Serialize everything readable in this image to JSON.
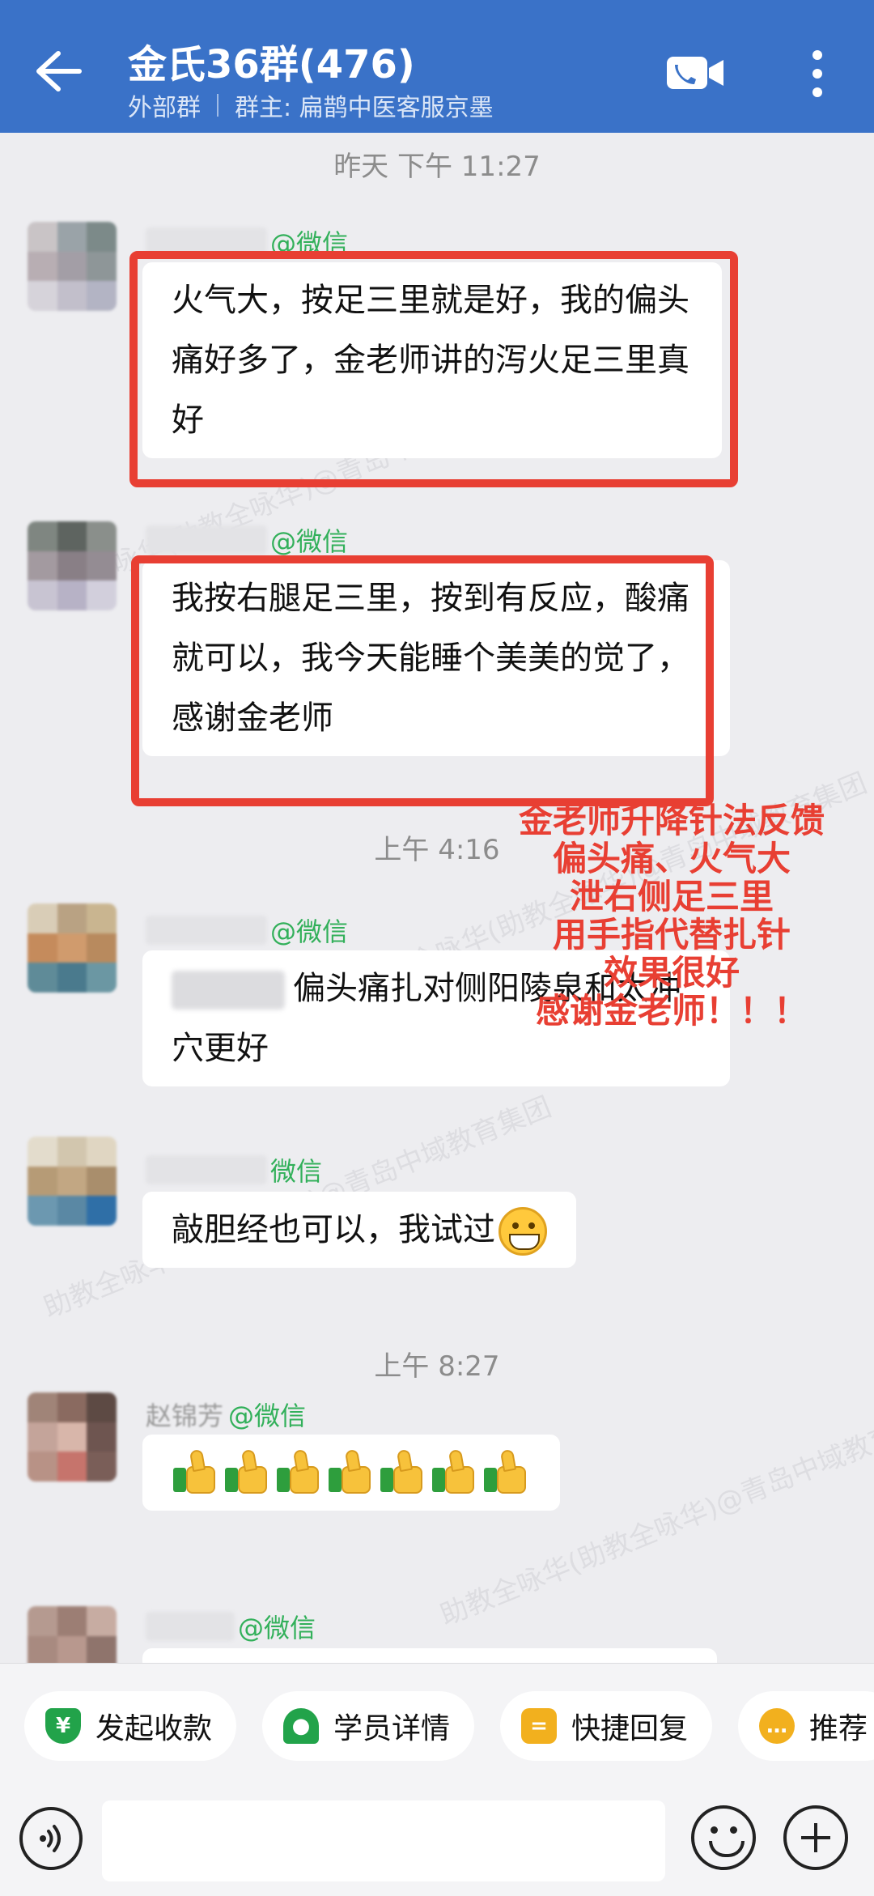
{
  "header": {
    "title": "金氏36群(476)",
    "group_type": "外部群",
    "owner": "群主: 扁鹊中医客服京墨"
  },
  "watermark": {
    "text": "助教全咏华(助教全咏华)@青岛中域教育集团"
  },
  "chat": {
    "time_1": "昨天  下午 11:27",
    "time_2": "上午 4:16",
    "time_3": "上午 8:27",
    "messages": [
      {
        "sender_suffix": "@微信",
        "text": "火气大，按足三里就是好，我的偏头痛好多了，金老师讲的泻火足三里真好"
      },
      {
        "sender_suffix": "@微信",
        "text": "我按右腿足三里，按到有反应，酸痛就可以，我今天能睡个美美的觉了，感谢金老师"
      },
      {
        "sender_suffix": "@微信",
        "text": "偏头痛扎对侧阳陵泉和太冲穴更好"
      },
      {
        "sender_suffix": "微信",
        "text": "敲胆经也可以，我试过",
        "emoji": "grinning-face"
      },
      {
        "sender_name_partial": "赵锦芳",
        "sender_suffix": "@微信",
        "emoji_count": 7,
        "emoji": "thumbs-up"
      },
      {
        "sender_suffix": "@微信"
      }
    ],
    "annotation": [
      "金老师升降针法反馈",
      "偏头痛、火气大",
      "泄右侧足三里",
      "用手指代替扎针",
      "效果很好",
      "感谢金老师！！！"
    ]
  },
  "quick_actions": [
    {
      "label": "发起收款",
      "icon": "payment-shield-icon",
      "color": "#22a34a"
    },
    {
      "label": "学员详情",
      "icon": "student-user-icon",
      "color": "#22a34a"
    },
    {
      "label": "快捷回复",
      "icon": "quick-reply-icon",
      "color": "#f2b01e"
    },
    {
      "label": "推荐",
      "icon": "recommend-icon",
      "color": "#f2b01e"
    }
  ],
  "input": {
    "placeholder": ""
  },
  "colors": {
    "header_bg": "#3a72c8",
    "annotation_red": "#e83f33",
    "sender_green": "#32b05a",
    "chat_bg": "#ededf0"
  }
}
